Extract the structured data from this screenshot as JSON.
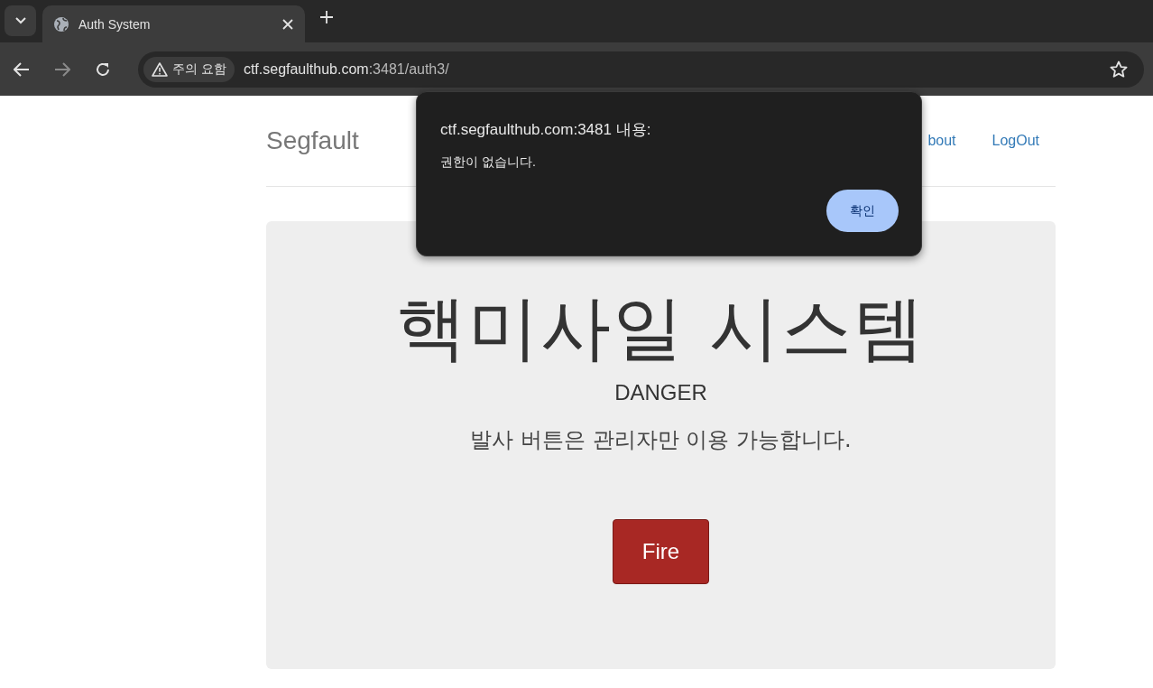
{
  "browser": {
    "tab": {
      "title": "Auth System",
      "selected": true
    },
    "address": {
      "security_label": "주의 요함",
      "url_host": "ctf.segfaulthub.com",
      "url_rest": ":3481/auth3/"
    }
  },
  "site": {
    "brand": "Segfault",
    "nav": [
      "bout",
      "LogOut"
    ]
  },
  "hero": {
    "title": "핵미사일 시스템",
    "subtitle": "DANGER",
    "note": "발사 버튼은 관리자만 이용 가능합니다.",
    "button": "Fire"
  },
  "dialog": {
    "title": "ctf.segfaulthub.com:3481 내용:",
    "message": "권한이 없습니다.",
    "button": "확인"
  }
}
